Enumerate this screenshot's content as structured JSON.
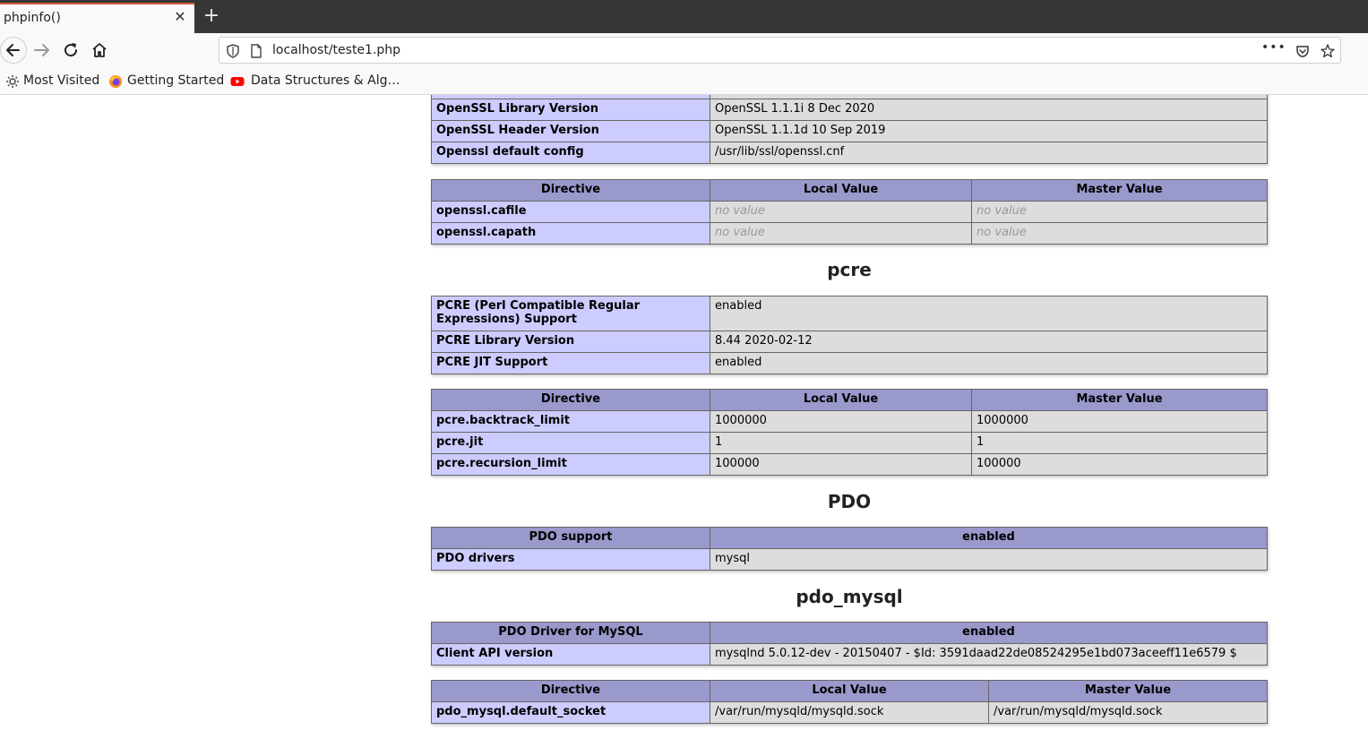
{
  "browser": {
    "tab_title": "phpinfo()",
    "tab_close": "✕",
    "new_tab": "+",
    "url": "localhost/teste1.php",
    "page_actions": "•••",
    "bookmarks": [
      "Most Visited",
      "Getting Started",
      "Data Structures & Alg…"
    ]
  },
  "openssl_table": {
    "rows": [
      {
        "name": "OpenSSL Library Version",
        "value": "OpenSSL 1.1.1i 8 Dec 2020"
      },
      {
        "name": "OpenSSL Header Version",
        "value": "OpenSSL 1.1.1d 10 Sep 2019"
      },
      {
        "name": "Openssl default config",
        "value": "/usr/lib/ssl/openssl.cnf"
      }
    ]
  },
  "openssl_directives": {
    "headers": [
      "Directive",
      "Local Value",
      "Master Value"
    ],
    "rows": [
      {
        "name": "openssl.cafile",
        "local": "no value",
        "master": "no value"
      },
      {
        "name": "openssl.capath",
        "local": "no value",
        "master": "no value"
      }
    ]
  },
  "pcre": {
    "title": "pcre",
    "info_rows": [
      {
        "name": "PCRE (Perl Compatible Regular Expressions) Support",
        "value": "enabled"
      },
      {
        "name": "PCRE Library Version",
        "value": "8.44 2020-02-12"
      },
      {
        "name": "PCRE JIT Support",
        "value": "enabled"
      }
    ],
    "headers": [
      "Directive",
      "Local Value",
      "Master Value"
    ],
    "directives": [
      {
        "name": "pcre.backtrack_limit",
        "local": "1000000",
        "master": "1000000"
      },
      {
        "name": "pcre.jit",
        "local": "1",
        "master": "1"
      },
      {
        "name": "pcre.recursion_limit",
        "local": "100000",
        "master": "100000"
      }
    ]
  },
  "pdo": {
    "title": "PDO",
    "header_left": "PDO support",
    "header_right": "enabled",
    "rows": [
      {
        "name": "PDO drivers",
        "value": "mysql"
      }
    ]
  },
  "pdo_mysql": {
    "title": "pdo_mysql",
    "header_left": "PDO Driver for MySQL",
    "header_right": "enabled",
    "rows": [
      {
        "name": "Client API version",
        "value": "mysqlnd 5.0.12-dev - 20150407 - $Id: 3591daad22de08524295e1bd073aceeff11e6579 $"
      }
    ],
    "headers": [
      "Directive",
      "Local Value",
      "Master Value"
    ],
    "directives": [
      {
        "name": "pdo_mysql.default_socket",
        "local": "/var/run/mysqld/mysqld.sock",
        "master": "/var/run/mysqld/mysqld.sock"
      }
    ]
  }
}
